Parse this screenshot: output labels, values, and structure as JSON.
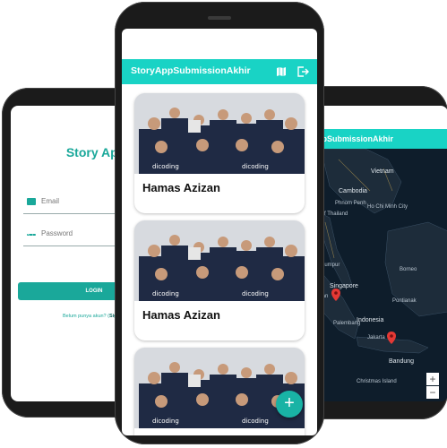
{
  "login_screen": {
    "title": "Story App",
    "email_placeholder": "Email",
    "password_placeholder": "Password",
    "login_label": "LOGIN",
    "signup_prompt": "Belum punya akun? (",
    "signup_link": "Sign up",
    "signup_suffix": ")"
  },
  "main_screen": {
    "app_title": "StoryAppSubmissionAkhir",
    "map_icon": "map-icon",
    "logout_icon": "logout-icon",
    "stories": [
      {
        "name": "Hamas Azizan",
        "photo_caption": "dicoding"
      },
      {
        "name": "Hamas Azizan",
        "photo_caption": "dicoding"
      },
      {
        "name": "",
        "photo_caption": "dicoding"
      }
    ],
    "fab_label": "+"
  },
  "map_screen": {
    "app_title": "ppSubmissionAkhir",
    "labels": [
      "Vietnam",
      "Cambodia",
      "Phnom Penh",
      "Ho Chi Minh City",
      "Gulf of Thailand",
      "Kuala Lumpur",
      "Singapore",
      "Indonesia",
      "Jakarta",
      "Bandung",
      "Christmas Island",
      "Borneo",
      "Medan",
      "Palembang",
      "Pontianak"
    ],
    "zoom_in": "+",
    "zoom_out": "−",
    "pin_color": "#e53935"
  }
}
